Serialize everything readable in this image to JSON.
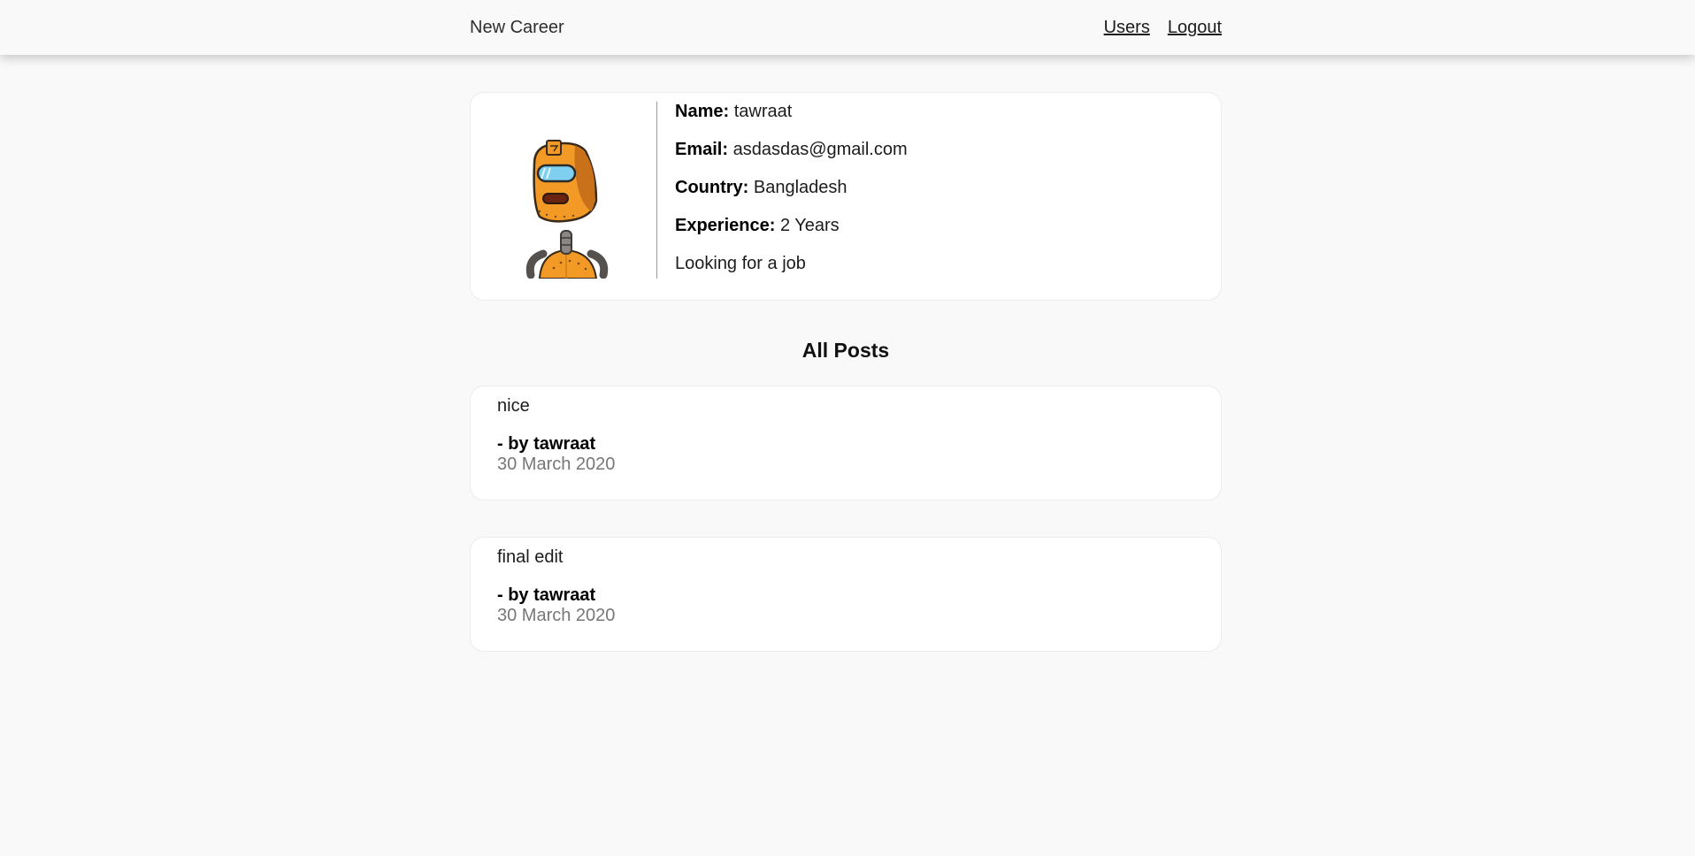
{
  "nav": {
    "brand": "New Career",
    "links": [
      {
        "label": "Users"
      },
      {
        "label": "Logout"
      }
    ]
  },
  "profile": {
    "avatar_icon": "robot-avatar-icon",
    "fields": [
      {
        "label": "Name:",
        "value": "tawraat"
      },
      {
        "label": "Email:",
        "value": "asdasdas@gmail.com"
      },
      {
        "label": "Country:",
        "value": "Bangladesh"
      },
      {
        "label": "Experience:",
        "value": "2 Years"
      }
    ],
    "status": "Looking for a job"
  },
  "posts_section": {
    "title": "All Posts"
  },
  "posts": [
    {
      "body": "nice",
      "author": "- by tawraat",
      "date": "30 March 2020"
    },
    {
      "body": "final edit",
      "author": "- by tawraat",
      "date": "30 March 2020"
    }
  ],
  "colors": {
    "background": "#f9f9f9",
    "card": "#ffffff",
    "muted_text": "#777777",
    "robot_orange": "#f39a26"
  }
}
